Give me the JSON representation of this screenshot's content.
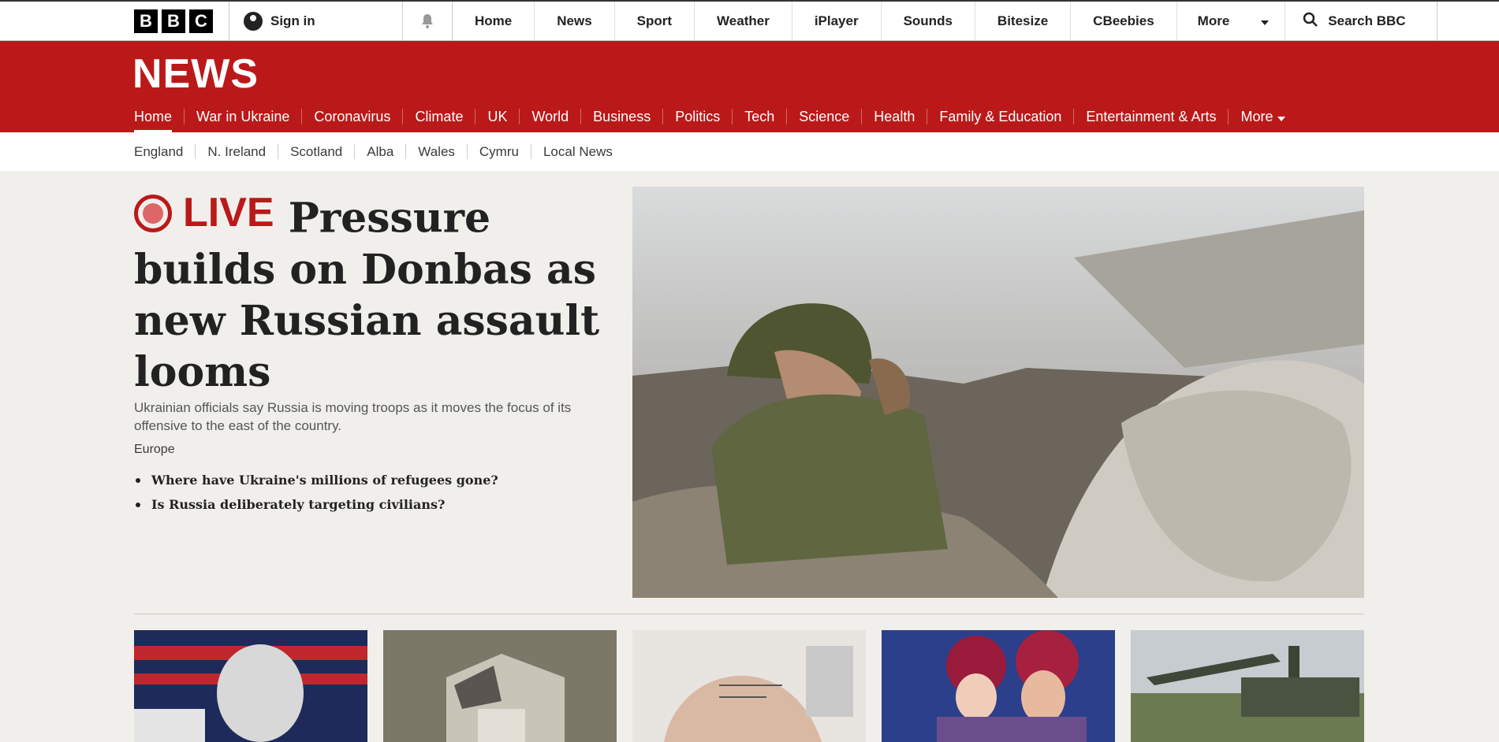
{
  "topbar": {
    "logo_letters": [
      "B",
      "B",
      "C"
    ],
    "signin_label": "Sign in",
    "nav": [
      "Home",
      "News",
      "Sport",
      "Weather",
      "iPlayer",
      "Sounds",
      "Bitesize",
      "CBeebies"
    ],
    "more_label": "More",
    "search_label": "Search BBC"
  },
  "brand": {
    "news_logo": "NEWS",
    "red": "#bb1919"
  },
  "main_nav": [
    "Home",
    "War in Ukraine",
    "Coronavirus",
    "Climate",
    "UK",
    "World",
    "Business",
    "Politics",
    "Tech",
    "Science",
    "Health",
    "Family & Education",
    "Entertainment & Arts"
  ],
  "main_nav_more": "More",
  "sub_nav": [
    "England",
    "N. Ireland",
    "Scotland",
    "Alba",
    "Wales",
    "Cymru",
    "Local News"
  ],
  "lead": {
    "live_label": "LIVE",
    "headline": "Pressure builds on Donbas as new Russian assault looms",
    "summary": "Ukrainian officials say Russia is moving troops as it moves the focus of its offensive to the east of the country.",
    "section": "Europe",
    "related": [
      "Where have Ukraine's millions of refugees gone?",
      "Is Russia deliberately targeting civilians?"
    ]
  }
}
